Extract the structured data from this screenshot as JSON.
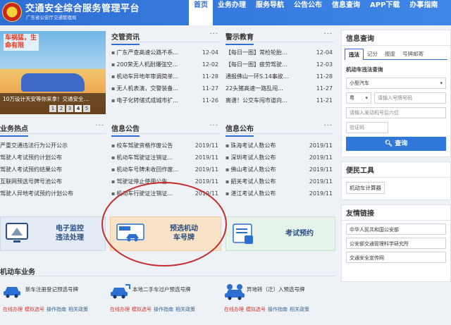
{
  "header": {
    "title": "交通安全综合服务管理平台",
    "subtitle": "广东省公安厅交通管理局",
    "nav": [
      "首页",
      "业务办理",
      "服务导航",
      "公告公布",
      "信息查询",
      "APP下载",
      "办事指南"
    ]
  },
  "banner": {
    "slogan": "车祸猛，生命有限",
    "caption": "10万设计天安等你来拿！交通安全...",
    "pages": [
      "1",
      "2",
      "3",
      "4",
      "5"
    ],
    "active_page": "4"
  },
  "news": {
    "title": "交管资讯",
    "more": "···",
    "items": [
      {
        "text": "广东严查高速公路不系...",
        "date": "12-04"
      },
      {
        "text": "200荣无人机耐爆弦空...",
        "date": "12-02"
      },
      {
        "text": "机动车异地年审调简单...",
        "date": "11-28"
      },
      {
        "text": "无人机表演，交警装备...",
        "date": "11-27"
      },
      {
        "text": "电子化转储式成城市扩...",
        "date": "11-26"
      }
    ]
  },
  "warning": {
    "title": "警示教育",
    "more": "···",
    "items": [
      {
        "text": "【每日一图】常检轮胎...",
        "date": "12-04"
      },
      {
        "text": "【每日一图】疲劳驾驶...",
        "date": "12-03"
      },
      {
        "text": "通报佛山一环S.14事故...",
        "date": "11-28"
      },
      {
        "text": "22头猪高速一路乱闯...",
        "date": "11-27"
      },
      {
        "text": "离谱！公交车闯市道向...",
        "date": "11-21"
      }
    ]
  },
  "hot": {
    "title": "业务热点",
    "more": "···",
    "items": [
      "严重交通违法行为公开公示",
      "驾驶人考试预约计划公布",
      "驾驶人考试预约结果公布",
      "互联网预选号牌号池公布",
      "驾驶人异地考试预约计划公布"
    ]
  },
  "notice": {
    "title": "信息公告",
    "more": "···",
    "items": [
      {
        "text": "校车驾驶资格作废公告",
        "date": "2019/11"
      },
      {
        "text": "机动车驾驶证注销证...",
        "date": "2019/11"
      },
      {
        "text": "机动车号牌未收回作废...",
        "date": "2019/11"
      },
      {
        "text": "驾驶证停止使用公告",
        "date": "2019/11"
      },
      {
        "text": "机动车行驶证注销证...",
        "date": "2019/11"
      }
    ]
  },
  "publish": {
    "title": "信息公布",
    "more": "···",
    "items": [
      {
        "text": "珠海考试人数公布",
        "date": "2019/11"
      },
      {
        "text": "深圳考试人数公布",
        "date": "2019/11"
      },
      {
        "text": "佛山考试人数公布",
        "date": "2019/11"
      },
      {
        "text": "韶关考试人数公布",
        "date": "2019/11"
      },
      {
        "text": "湛江考试人数公布",
        "date": "2019/11"
      }
    ]
  },
  "services": [
    {
      "label": "电子监控\n违法处理"
    },
    {
      "label": "预选机动\n车号牌"
    },
    {
      "label": "考试预约"
    }
  ],
  "business": {
    "title": "机动车业务",
    "items": [
      {
        "name": "新车注册登记预选号牌",
        "links": [
          "在线办理",
          "模拟选号",
          "操作指南",
          "相关政策"
        ]
      },
      {
        "name": "本地二手车过户预选号牌",
        "links": [
          "在线办理",
          "模拟选号",
          "操作指南",
          "相关政策"
        ]
      },
      {
        "name": "异地转（迁）入预选号牌",
        "links": [
          "在线办理",
          "模拟选号",
          "操作指南",
          "相关政策"
        ]
      }
    ]
  },
  "sidebar": {
    "query": {
      "title": "信息查询",
      "tabs": [
        "违法",
        "记分",
        "报废",
        "号牌邮寄"
      ],
      "subtitle": "机动车违法查询",
      "vehicle_type": "小型汽车",
      "province": "粤",
      "plate_placeholder": "请输入号牌号码",
      "vin_placeholder": "请输入发动机号后六位",
      "code_placeholder": "验证码",
      "button": "查询"
    },
    "tools": {
      "title": "便民工具",
      "items": [
        "机动车计算器"
      ]
    },
    "links": {
      "title": "友情链接",
      "items": [
        "中华人民共和国公安部",
        "公安部交通管理科学研究所",
        "交通安全宣传网"
      ]
    }
  },
  "colors": {
    "brand": "#2f6ed3",
    "highlight": "#c62b2b",
    "accent_red": "#d23b2e"
  }
}
